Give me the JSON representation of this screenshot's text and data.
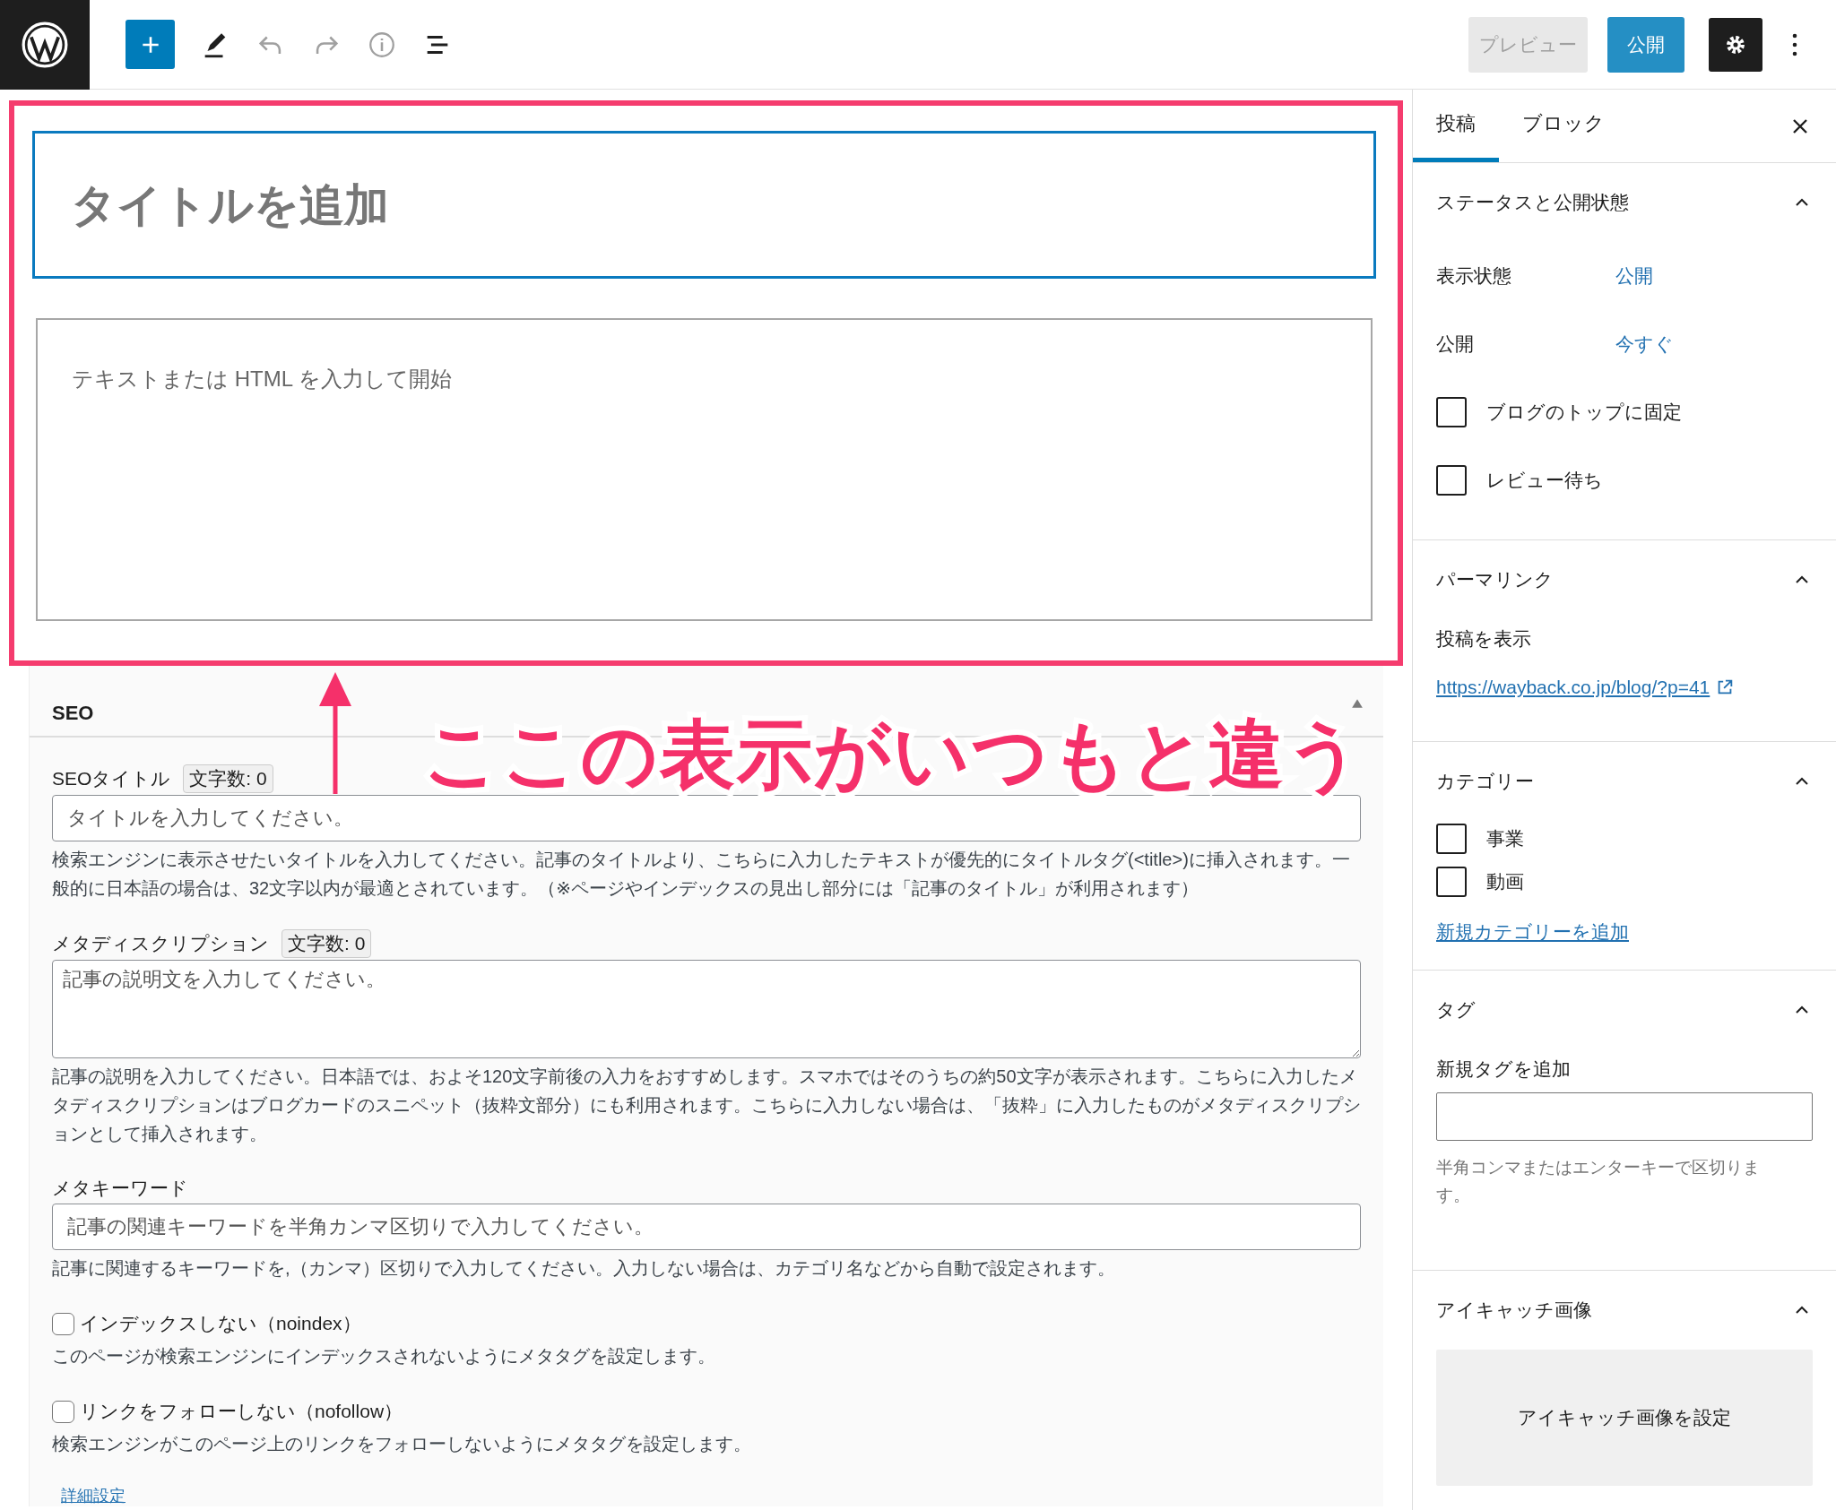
{
  "toolbar": {
    "preview_button": "プレビュー",
    "publish_button": "公開"
  },
  "editor": {
    "title_placeholder": "タイトルを追加",
    "body_placeholder": "テキストまたは HTML を入力して開始"
  },
  "annotation": {
    "text": "ここの表示がいつもと違う"
  },
  "seo_panel": {
    "title": "SEO",
    "expanded": true,
    "fields": [
      {
        "kind": "input",
        "label": "SEOタイトル",
        "counter": "文字数: 0",
        "placeholder": "タイトルを入力してください。",
        "help": "検索エンジンに表示させたいタイトルを入力してください。記事のタイトルより、こちらに入力したテキストが優先的にタイトルタグ(<title>)に挿入されます。一般的に日本語の場合は、32文字以内が最適とされています。（※ページやインデックスの見出し部分には「記事のタイトル」が利用されます）"
      },
      {
        "kind": "textarea",
        "label": "メタディスクリプション",
        "counter": "文字数: 0",
        "placeholder": "記事の説明文を入力してください。",
        "help": "記事の説明を入力してください。日本語では、およそ120文字前後の入力をおすすめします。スマホではそのうちの約50文字が表示されます。こちらに入力したメタディスクリプションはブログカードのスニペット（抜粋文部分）にも利用されます。こちらに入力しない場合は、「抜粋」に入力したものがメタディスクリプションとして挿入されます。"
      },
      {
        "kind": "input",
        "label": "メタキーワード",
        "placeholder": "記事の関連キーワードを半角カンマ区切りで入力してください。",
        "help": "記事に関連するキーワードを,（カンマ）区切りで入力してください。入力しない場合は、カテゴリ名などから自動で設定されます。"
      },
      {
        "kind": "checkbox",
        "label": "インデックスしない（noindex）",
        "checked": false,
        "help": "このページが検索エンジンにインデックスされないようにメタタグを設定します。"
      },
      {
        "kind": "checkbox",
        "label": "リンクをフォローしない（nofollow）",
        "checked": false,
        "help": "検索エンジンがこのページ上のリンクをフォローしないようにメタタグを設定します。"
      }
    ],
    "advanced_link": "詳細設定"
  },
  "sidebar": {
    "tabs": [
      {
        "label": "投稿",
        "selected": true
      },
      {
        "label": "ブロック",
        "selected": false
      }
    ],
    "status": {
      "title": "ステータスと公開状態",
      "expanded": true,
      "rows": [
        {
          "label": "表示状態",
          "value": "公開"
        },
        {
          "label": "公開",
          "value": "今すぐ"
        }
      ],
      "checkboxes": [
        {
          "label": "ブログのトップに固定",
          "checked": false
        },
        {
          "label": "レビュー待ち",
          "checked": false
        }
      ]
    },
    "permalink": {
      "title": "パーマリンク",
      "expanded": true,
      "label": "投稿を表示",
      "url": "https://wayback.co.jp/blog/?p=41"
    },
    "categories": {
      "title": "カテゴリー",
      "expanded": true,
      "items": [
        {
          "label": "事業",
          "checked": false
        },
        {
          "label": "動画",
          "checked": false
        }
      ],
      "add_link": "新規カテゴリーを追加"
    },
    "tags": {
      "title": "タグ",
      "expanded": true,
      "label": "新規タグを追加",
      "help": "半角コンマまたはエンターキーで区切ります。"
    },
    "featured_image": {
      "title": "アイキャッチ画像",
      "expanded": true,
      "button": "アイキャッチ画像を設定"
    }
  }
}
